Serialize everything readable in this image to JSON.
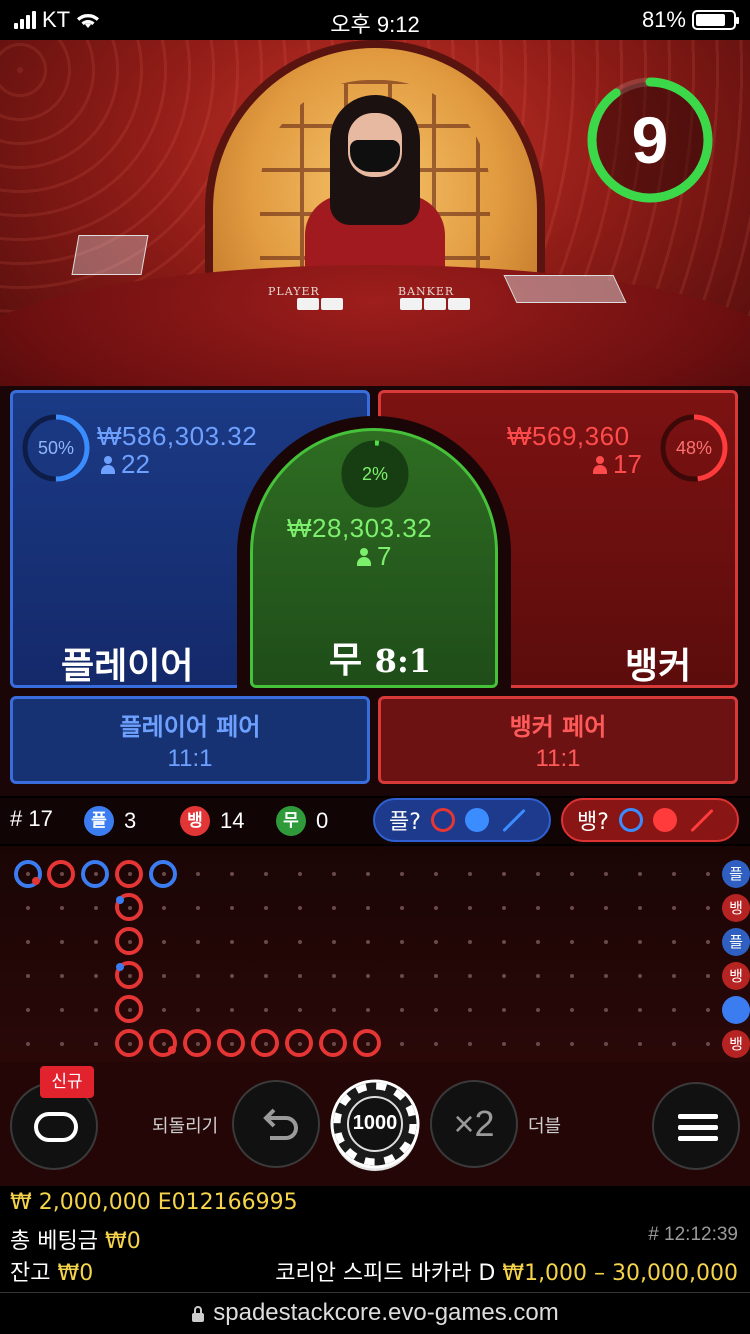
{
  "status": {
    "carrier": "KT",
    "time": "오후 9:12",
    "battery": "81%",
    "battery_level": 0.81
  },
  "video": {
    "label_player": "PLAYER",
    "label_banker": "BANKER",
    "countdown": "9",
    "countdown_fraction": 0.9
  },
  "player": {
    "label": "플레이어",
    "amount": "₩586,303.32",
    "players": "22",
    "percent": "50%",
    "percent_value": 0.5,
    "color": "#3a6ddc"
  },
  "tie": {
    "label": "무",
    "odds": "8:1",
    "amount": "₩28,303.32",
    "players": "7",
    "percent": "2%",
    "percent_value": 0.02,
    "color": "#46c23a"
  },
  "banker": {
    "label": "뱅커",
    "amount": "₩569,360",
    "players": "17",
    "percent": "48%",
    "percent_value": 0.48,
    "color": "#d83a3a"
  },
  "player_pair": {
    "label": "플레이어 페어",
    "odds": "11:1"
  },
  "banker_pair": {
    "label": "뱅커 페어",
    "odds": "11:1"
  },
  "stats": {
    "round": "# 17",
    "player_badge": "플",
    "player_count": "3",
    "banker_badge": "뱅",
    "banker_count": "14",
    "tie_badge": "무",
    "tie_count": "0"
  },
  "predict": {
    "player_label": "플?",
    "banker_label": "뱅?"
  },
  "road_side": {
    "labels": [
      "플",
      "뱅",
      "플",
      "뱅",
      "",
      "뱅"
    ]
  },
  "controls": {
    "new_badge": "신규",
    "undo_label": "되돌리기",
    "chip_value": "1000",
    "double_icon_text": "×2",
    "double_label": "더블"
  },
  "footer": {
    "balance_line": "₩ 2,000,000 E012166995",
    "total_bet_label": "총 베팅금",
    "total_bet_value": "₩0",
    "round_id": "# 12:12:39",
    "remaining_label": "잔고",
    "remaining_value": "₩0",
    "table_name": "코리안 스피드 바카라 D",
    "limits": "₩1,000 – 30,000,000"
  },
  "url": "spadestackcore.evo-games.com"
}
